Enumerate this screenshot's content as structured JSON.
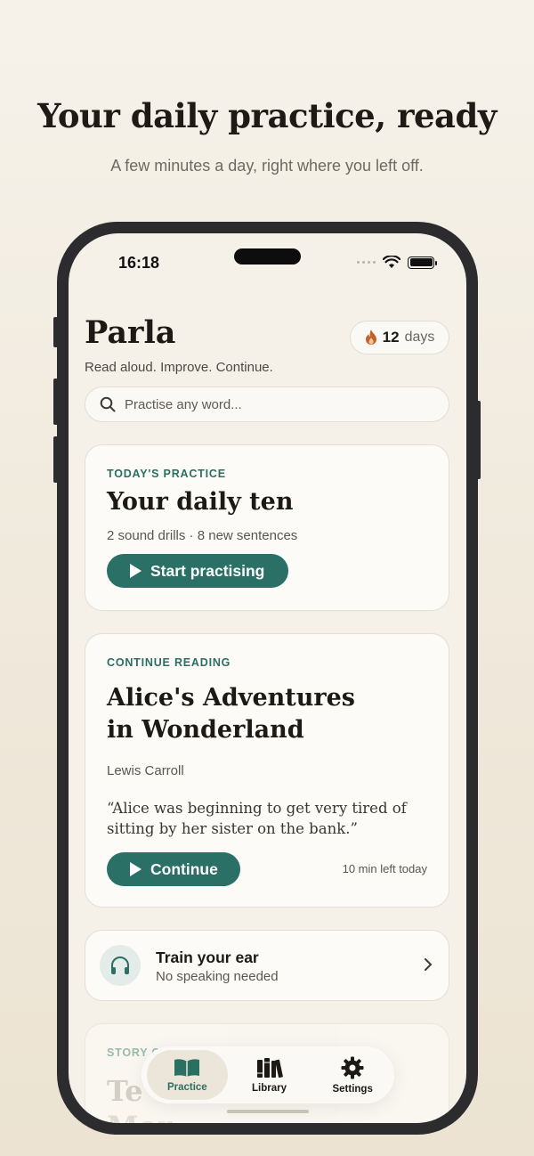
{
  "promo": {
    "headline": "Your daily practice, ready",
    "subline": "A few minutes a day, right where you left off."
  },
  "status_bar": {
    "time": "16:18"
  },
  "app": {
    "title": "Parla",
    "tagline": "Read aloud. Improve. Continue.",
    "streak": {
      "count": "12",
      "unit": "days",
      "icon": "flame-icon"
    }
  },
  "search": {
    "placeholder": "Practise any word..."
  },
  "practice_card": {
    "eyebrow": "TODAY'S PRACTICE",
    "title": "Your daily ten",
    "detail": "2 sound drills · 8 new sentences",
    "button": "Start practising"
  },
  "reading_card": {
    "eyebrow": "CONTINUE READING",
    "title_line1": "Alice's Adventures",
    "title_line2": "in Wonderland",
    "author": "Lewis Carroll",
    "quote": "“Alice was beginning to get very tired of sitting by her sister on the bank.”",
    "button": "Continue",
    "time_left": "10 min left today"
  },
  "ear_card": {
    "title": "Train your ear",
    "subtitle": "No speaking needed",
    "icon": "headphones-icon"
  },
  "story_card": {
    "eyebrow": "STORY C",
    "title_partial": "Te",
    "title_partial_2": "Mor"
  },
  "tabs": [
    {
      "label": "Practice",
      "icon": "book-open-icon",
      "active": true
    },
    {
      "label": "Library",
      "icon": "books-icon",
      "active": false
    },
    {
      "label": "Settings",
      "icon": "gear-icon",
      "active": false
    }
  ],
  "colors": {
    "accent": "#2a7066",
    "background": "#f5f1e8",
    "flame": "#c0622a"
  }
}
